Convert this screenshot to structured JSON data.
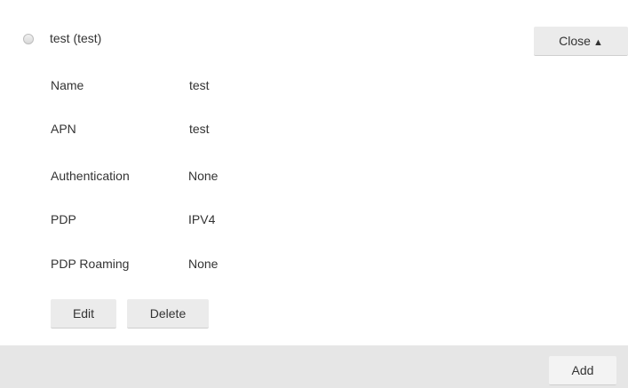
{
  "profile": {
    "title": "test (test)",
    "close_label": "Close",
    "close_arrow": "▲",
    "details": [
      {
        "label": "Name",
        "value": "test"
      },
      {
        "label": "APN",
        "value": "test"
      },
      {
        "label": "Authentication",
        "value": "None"
      },
      {
        "label": "PDP",
        "value": "IPV4"
      },
      {
        "label": "PDP Roaming",
        "value": "None"
      }
    ],
    "edit_label": "Edit",
    "delete_label": "Delete"
  },
  "footer": {
    "add_label": "Add"
  }
}
